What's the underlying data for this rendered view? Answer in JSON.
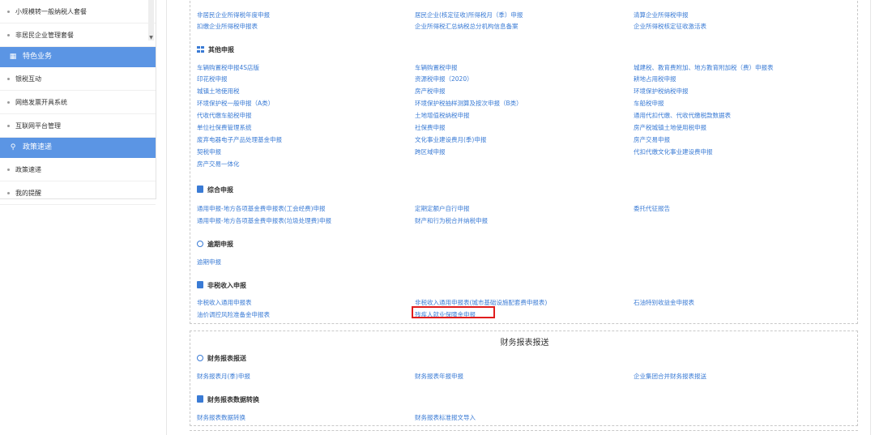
{
  "sidebar": {
    "items": [
      {
        "type": "item",
        "label": "小规模转一般纳税人套餐"
      },
      {
        "type": "item",
        "label": "非居民企业管理套餐"
      },
      {
        "type": "head",
        "label": "特色业务",
        "icon": "grid-icon"
      },
      {
        "type": "item",
        "label": "银税互动"
      },
      {
        "type": "item",
        "label": "网络发票开具系统"
      },
      {
        "type": "item",
        "label": "互联网平台管理"
      },
      {
        "type": "head",
        "label": "政策速递",
        "icon": "user-icon"
      },
      {
        "type": "item",
        "label": "政策速递"
      },
      {
        "type": "item",
        "label": "我的提醒"
      }
    ]
  },
  "box1": {
    "top_links": [
      [
        "非居民企业所得税年度申报",
        "居民企业(核定征收)所得税月（季）申报",
        "清算企业所得税申报"
      ],
      [
        "扣缴企业所得税申报表",
        "企业所得税汇总纳税总分机构信息备案",
        "企业所得税核定征收激活表"
      ]
    ],
    "sections": [
      {
        "title": "其他申报",
        "icon": "grid",
        "rows": [
          [
            "车辆购置税申报4S店版",
            "车辆购置税申报",
            "城建税、教育费附加、地方教育附加税（费）申报表"
          ],
          [
            "印花税申报",
            "资源税申报（2020）",
            "耕地占用税申报"
          ],
          [
            "城镇土地使用税",
            "房产税申报",
            "环境保护税纳税申报"
          ],
          [
            "环境保护税一般申报（A类）",
            "环境保护税抽样测算及按次申报（B类）",
            "车船税申报"
          ],
          [
            "代收代缴车船税申报",
            "土地增值税纳税申报",
            "通用代扣代缴、代收代缴税款数据表"
          ],
          [
            "单位社保费管理系统",
            "社保费申报",
            "房产税城镇土地使用税申报"
          ],
          [
            "废弃电器电子产品处理基金申报",
            "文化事业建设费月(季)申报",
            "房产交易申报"
          ],
          [
            "契税申报",
            "跨区域申报",
            "代扣代缴文化事业建设费申报"
          ],
          [
            "房产交易一体化",
            "",
            ""
          ]
        ]
      },
      {
        "title": "综合申报",
        "icon": "doc",
        "rows": [
          [
            "通用申报-地方各项基金费申报表(工会经费)申报",
            "定期定额户自行申报",
            "委托代征报告"
          ],
          [
            "通用申报-地方各项基金费申报表(垃圾处理费)申报",
            "财产和行为税合并纳税申报",
            ""
          ]
        ]
      },
      {
        "title": "逾期申报",
        "icon": "ring",
        "rows": [
          [
            "逾期申报",
            "",
            ""
          ]
        ]
      },
      {
        "title": "非税收入申报",
        "icon": "doc",
        "rows": [
          [
            "非税收入通用申报表",
            "非税收入通用申报表(城市基础设施配套费申报表)",
            "石油特别收益金申报表"
          ],
          [
            "油价调控风险准备金申报表",
            "残疾人就业保障金申报",
            ""
          ]
        ]
      }
    ]
  },
  "box2": {
    "title": "财务报表报送",
    "sections": [
      {
        "title": "财务报表报送",
        "icon": "ring",
        "rows": [
          [
            "财务报表月(季)申报",
            "财务报表年报申报",
            "企业集团合并财务报表报送"
          ]
        ]
      },
      {
        "title": "财务报表数据转换",
        "icon": "doc",
        "rows": [
          [
            "财务报表数据转换",
            "财务报表标准报文导入",
            ""
          ]
        ]
      }
    ]
  },
  "highlighted_item": "残疾人就业保障金申报",
  "colors": {
    "accent": "#5b95e4",
    "link": "#3a7bd5",
    "highlight": "#e01d1d"
  }
}
